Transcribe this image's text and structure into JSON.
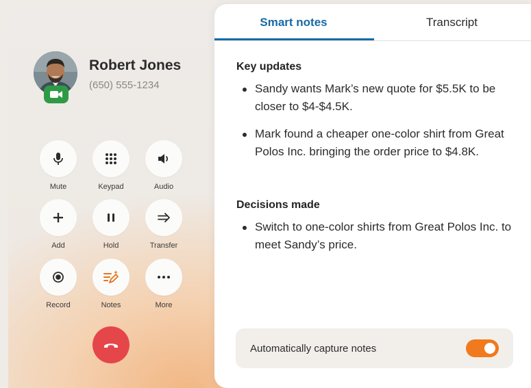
{
  "caller": {
    "name": "Robert Jones",
    "number": "(650) 555-1234"
  },
  "controls": [
    {
      "label": "Mute",
      "icon": "microphone-icon"
    },
    {
      "label": "Keypad",
      "icon": "keypad-icon"
    },
    {
      "label": "Audio",
      "icon": "speaker-icon"
    },
    {
      "label": "Add",
      "icon": "plus-icon"
    },
    {
      "label": "Hold",
      "icon": "pause-icon"
    },
    {
      "label": "Transfer",
      "icon": "transfer-arrow-icon"
    },
    {
      "label": "Record",
      "icon": "record-icon"
    },
    {
      "label": "Notes",
      "icon": "notes-icon"
    },
    {
      "label": "More",
      "icon": "more-dots-icon"
    }
  ],
  "tabs": [
    {
      "label": "Smart notes",
      "active": true
    },
    {
      "label": "Transcript",
      "active": false
    }
  ],
  "notes": {
    "key_updates_title": "Key updates",
    "key_updates": [
      "Sandy wants Mark’s new quote for $5.5K to be closer to $4-$4.5K.",
      "Mark found a cheaper one-color shirt from Great Polos Inc. bringing the order price to $4.8K."
    ],
    "decisions_title": "Decisions made",
    "decisions": [
      "Switch to one-color shirts from Great Polos Inc. to meet Sandy’s price."
    ]
  },
  "auto_capture": {
    "label": "Automatically capture notes",
    "enabled": true
  },
  "colors": {
    "accent_blue": "#1769a6",
    "toggle_orange": "#f07a1d",
    "hangup_red": "#e5464a",
    "video_green": "#2f9a46",
    "notes_orange": "#e8731c"
  }
}
